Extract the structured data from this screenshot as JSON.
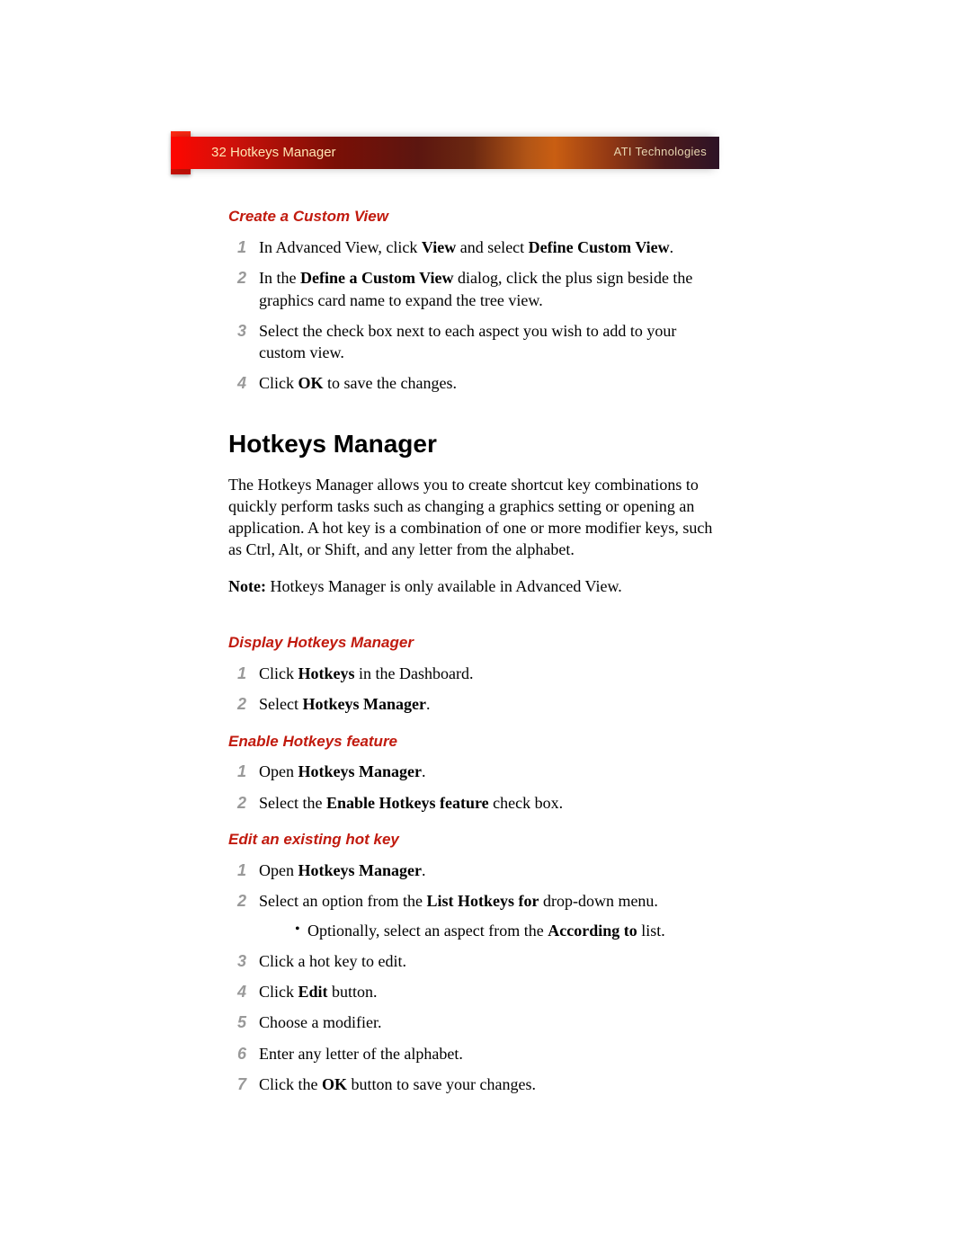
{
  "header": {
    "page_number": "32",
    "section": "Hotkeys Manager",
    "brand": "ATI Technologies"
  },
  "sec_custom": {
    "title": "Create a Custom View",
    "s1_a": "In Advanced View, click ",
    "s1_b": "View",
    "s1_c": " and select ",
    "s1_d": "Define Custom View",
    "s1_e": ".",
    "s2_a": "In the ",
    "s2_b": "Define a Custom View",
    "s2_c": " dialog, click the plus sign beside the graphics card name to expand the tree view.",
    "s3": "Select the check box next to each aspect you wish to add to your custom view.",
    "s4_a": "Click ",
    "s4_b": "OK",
    "s4_c": " to save the changes."
  },
  "main": {
    "heading": "Hotkeys Manager",
    "intro": "The Hotkeys Manager allows you to create shortcut key combinations to quickly perform tasks such as changing a graphics setting or opening an application. A hot key is a combination of one or more modifier keys, such as Ctrl, Alt, or Shift, and any letter from the alphabet.",
    "note_label": "Note:",
    "note_text": "  Hotkeys Manager is only available in Advanced View."
  },
  "sec_display": {
    "title": "Display Hotkeys Manager",
    "s1_a": "Click ",
    "s1_b": "Hotkeys",
    "s1_c": " in the Dashboard.",
    "s2_a": "Select ",
    "s2_b": "Hotkeys Manager",
    "s2_c": "."
  },
  "sec_enable": {
    "title": "Enable Hotkeys feature",
    "s1_a": "Open ",
    "s1_b": "Hotkeys Manager",
    "s1_c": ".",
    "s2_a": "Select the ",
    "s2_b": "Enable Hotkeys feature",
    "s2_c": " check box."
  },
  "sec_edit": {
    "title": "Edit an existing hot key",
    "s1_a": "Open ",
    "s1_b": "Hotkeys Manager",
    "s1_c": ".",
    "s2_a": "Select an option from the ",
    "s2_b": "List Hotkeys for",
    "s2_c": " drop-down menu.",
    "s2_sub_a": "Optionally, select an aspect from the ",
    "s2_sub_b": "According to",
    "s2_sub_c": " list.",
    "s3": "Click a hot key to edit.",
    "s4_a": "Click ",
    "s4_b": "Edit",
    "s4_c": " button.",
    "s5": "Choose a modifier.",
    "s6": "Enter any letter of the alphabet.",
    "s7_a": "Click the ",
    "s7_b": "OK",
    "s7_c": " button to save your changes."
  }
}
